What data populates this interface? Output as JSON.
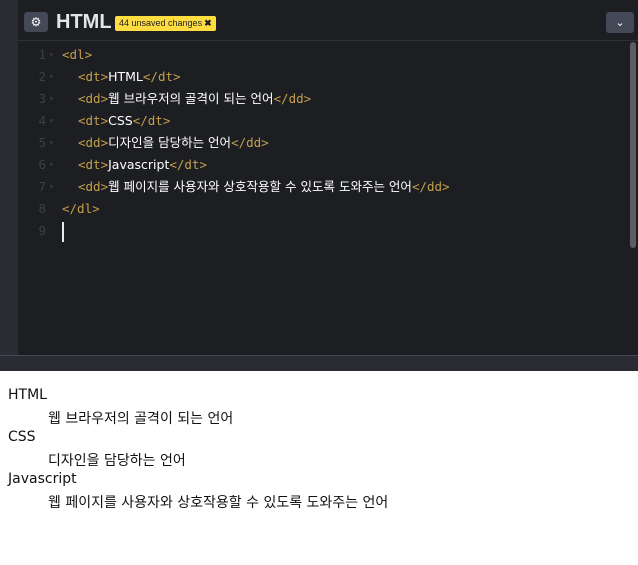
{
  "header": {
    "settings_icon": "gear-icon",
    "title": "HTML",
    "badge": "44 unsaved changes",
    "badge_close": "✖",
    "collapse_icon": "chevron-down-icon"
  },
  "code_lines": [
    {
      "num": "1",
      "fold": "▾",
      "open": "<dl>",
      "text": "",
      "close": ""
    },
    {
      "num": "2",
      "fold": "▾",
      "open": "<dt>",
      "text": "HTML",
      "close": "</dt>"
    },
    {
      "num": "3",
      "fold": "▾",
      "open": "<dd>",
      "text": "웹 브라우저의 골격이 되는 언어",
      "close": "</dd>"
    },
    {
      "num": "4",
      "fold": "▾",
      "open": "<dt>",
      "text": "CSS",
      "close": "</dt>"
    },
    {
      "num": "5",
      "fold": "▾",
      "open": "<dd>",
      "text": "디자인을 담당하는 언어",
      "close": "</dd>"
    },
    {
      "num": "6",
      "fold": "▾",
      "open": "<dt>",
      "text": "Javascript",
      "close": "</dt>"
    },
    {
      "num": "7",
      "fold": "▾",
      "open": "<dd>",
      "text": "웹 페이지를 사용자와 상호작용할 수 있도록 도와주는 언어",
      "close": "</dd>"
    },
    {
      "num": "8",
      "fold": "",
      "open": "</dl>",
      "text": "",
      "close": ""
    },
    {
      "num": "9",
      "fold": "",
      "open": "",
      "text": "",
      "close": ""
    }
  ],
  "preview": [
    {
      "kind": "dt",
      "text": "HTML"
    },
    {
      "kind": "dd",
      "text": "웹 브라우저의 골격이 되는 언어"
    },
    {
      "kind": "dt",
      "text": "CSS"
    },
    {
      "kind": "dd",
      "text": "디자인을 담당하는 언어"
    },
    {
      "kind": "dt",
      "text": "Javascript"
    },
    {
      "kind": "dd",
      "text": "웹 페이지를 사용자와 상호작용할 수 있도록 도와주는 언어"
    }
  ],
  "colors": {
    "editor_bg": "#1d1e22",
    "tag": "#c4a04d",
    "badge_bg": "#ffdd40"
  }
}
